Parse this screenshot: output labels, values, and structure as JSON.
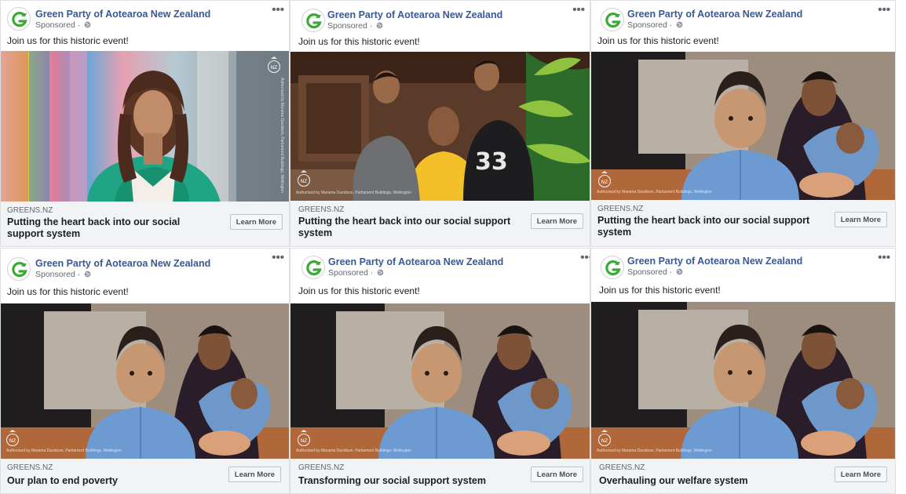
{
  "ads": [
    {
      "page_name": "Green Party of Aotearoa New Zealand",
      "sponsored": "Sponsored ·",
      "primary_text": "Join us for this historic event!",
      "photo": "woman-portrait-photo",
      "domain": "GREENS.NZ",
      "headline": "Putting the heart back into our social support system",
      "cta": "Learn More"
    },
    {
      "page_name": "Green Party of Aotearoa New Zealand",
      "sponsored": "Sponsored ·",
      "primary_text": "Join us for this historic event!",
      "photo": "father-and-sons-photo",
      "domain": "GREENS.NZ",
      "headline": "Putting the heart back into our social support system",
      "cta": "Learn More"
    },
    {
      "page_name": "Green Party of Aotearoa New Zealand",
      "sponsored": "Sponsored ·",
      "primary_text": "Join us for this historic event!",
      "photo": "toddler-and-family-photo",
      "domain": "GREENS.NZ",
      "headline": "Putting the heart back into our social support system",
      "cta": "Learn More"
    },
    {
      "page_name": "Green Party of Aotearoa New Zealand",
      "sponsored": "Sponsored ·",
      "primary_text": "Join us for this historic event!",
      "photo": "toddler-and-family-photo",
      "domain": "GREENS.NZ",
      "headline": "Our plan to end poverty",
      "cta": "Learn More"
    },
    {
      "page_name": "Green Party of Aotearoa New Zealand",
      "sponsored": "Sponsored ·",
      "primary_text": "Join us for this historic event!",
      "photo": "toddler-and-family-photo",
      "domain": "GREENS.NZ",
      "headline": "Transforming our social support system",
      "cta": "Learn More"
    },
    {
      "page_name": "Green Party of Aotearoa New Zealand",
      "sponsored": "Sponsored ·",
      "primary_text": "Join us for this historic event!",
      "photo": "toddler-and-family-photo",
      "domain": "GREENS.NZ",
      "headline": "Overhauling our welfare system",
      "cta": "Learn More"
    }
  ],
  "image_authorisation_text": "Authorised by Marama Davidson, Parliament Buildings, Wellington",
  "colors": {
    "page_name": "#385898",
    "logo_green": "#3aa935",
    "footer_bg": "#f2f3f5"
  },
  "icons": {
    "logo": "green-party-g-logo-icon",
    "globe": "globe-icon",
    "more": "more-options-icon",
    "crest": "nz-crest-icon"
  }
}
